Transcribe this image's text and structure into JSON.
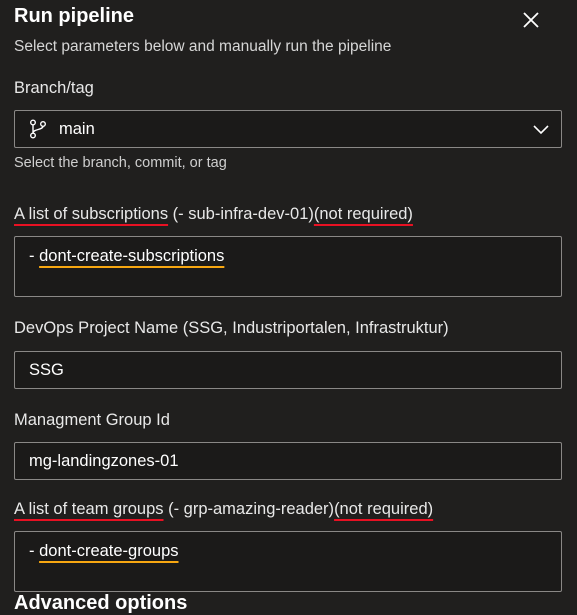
{
  "panel": {
    "title": "Run pipeline",
    "subtitle": "Select parameters below and manually run the pipeline",
    "close_icon": "close-icon"
  },
  "branch": {
    "label": "Branch/tag",
    "value": "main",
    "icon": "branch-icon",
    "hint": "Select the branch, commit, or tag"
  },
  "subscriptions": {
    "label_main": "A list of subscriptions",
    "label_example": " (- sub-infra-dev-01)",
    "label_note": "(not required)",
    "value_prefix": "- ",
    "value": "dont-create-subscriptions"
  },
  "devops_project": {
    "label": "DevOps Project Name (SSG, Industriportalen, Infrastruktur)",
    "value": "SSG"
  },
  "management_group": {
    "label": "Managment Group Id",
    "value": "mg-landingzones-01"
  },
  "team_groups": {
    "label_main": "A list of team groups",
    "label_example": " (- grp-amazing-reader)",
    "label_note": "(not required)",
    "value_prefix": "- ",
    "value": "dont-create-groups"
  },
  "advanced": {
    "label": "Advanced options"
  },
  "colors": {
    "background": "#201f1e",
    "field_border": "#8a8886",
    "annotation_red": "#e81123",
    "annotation_orange": "#f7a711"
  }
}
